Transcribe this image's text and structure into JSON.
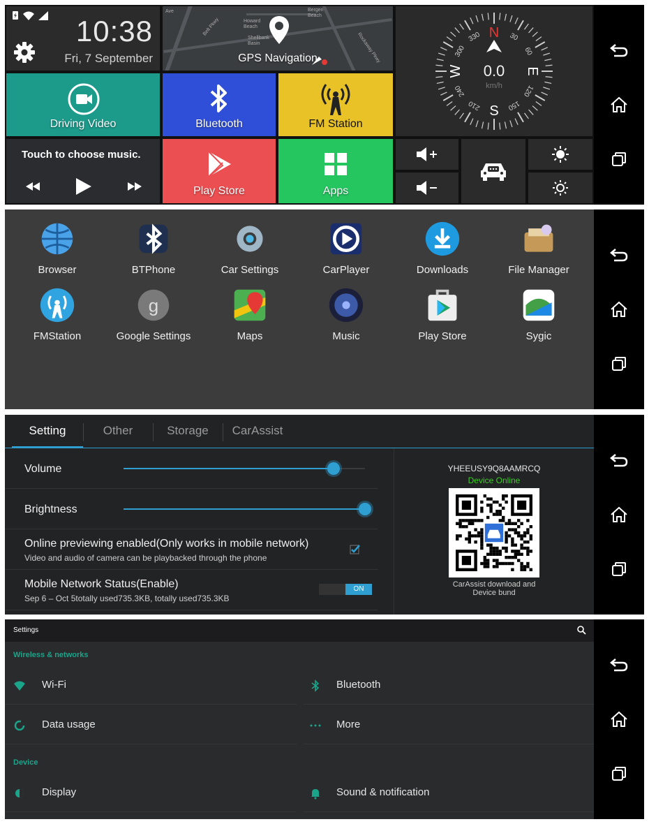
{
  "colors": {
    "teal": "#1c9a8a",
    "blue": "#2f4fd8",
    "yellow": "#e8c226",
    "red": "#ec4f52",
    "green": "#25c560",
    "accent": "#2e9fd0",
    "settings_accent": "#1aa58b",
    "online": "#38d11d"
  },
  "home": {
    "time": "10:38",
    "date": "Fri, 7 September",
    "gps_label": "GPS Navigation",
    "map_labels": [
      "Howard Beach",
      "Shellbank Basin",
      "Belt Pkwy",
      "Bergen Beach",
      "Ave",
      "Rockaway Pkwy"
    ],
    "compass": {
      "north": "N",
      "south": "S",
      "east": "E",
      "west": "W",
      "speed": "0.0",
      "unit": "km/h",
      "ticks": [
        "330",
        "30",
        "300",
        "60",
        "240",
        "120",
        "210",
        "150"
      ]
    },
    "tiles": {
      "driving_video": "Driving Video",
      "bluetooth": "Bluetooth",
      "fm_station": "FM Station",
      "music_prompt": "Touch to choose music.",
      "play_store": "Play Store",
      "apps": "Apps"
    }
  },
  "drawer": {
    "apps": [
      {
        "label": "Browser",
        "icon": "globe-icon"
      },
      {
        "label": "BTPhone",
        "icon": "bluetooth-phone-icon"
      },
      {
        "label": "Car Settings",
        "icon": "gear-icon"
      },
      {
        "label": "CarPlayer",
        "icon": "play-circle-icon"
      },
      {
        "label": "Downloads",
        "icon": "download-icon"
      },
      {
        "label": "File Manager",
        "icon": "folder-icon"
      },
      {
        "label": "FMStation",
        "icon": "radio-tower-icon"
      },
      {
        "label": "Google Settings",
        "icon": "google-settings-icon"
      },
      {
        "label": "Maps",
        "icon": "map-pin-icon"
      },
      {
        "label": "Music",
        "icon": "speaker-icon"
      },
      {
        "label": "Play Store",
        "icon": "play-store-icon"
      },
      {
        "label": "Sygic",
        "icon": "sygic-icon"
      }
    ]
  },
  "carassist": {
    "tabs": [
      "Setting",
      "Other",
      "Storage",
      "CarAssist"
    ],
    "volume_label": "Volume",
    "volume_level": 0.87,
    "brightness_label": "Brightness",
    "brightness_level": 1.0,
    "preview_title": "Online previewing enabled(Only works in mobile network)",
    "preview_sub": "Video and audio of camera can be playbacked through the phone",
    "network_title": "Mobile Network Status(Enable)",
    "network_sub": "Sep 6 – Oct 5totally used735.3KB, totally used735.3KB",
    "toggle_on": "ON",
    "device_id": "YHEEUSY9Q8AAMRCQ",
    "device_status": "Device Online",
    "qr_caption_1": "CarAssist download and",
    "qr_caption_2": "Device bund"
  },
  "settings": {
    "title": "Settings",
    "section_wireless": "Wireless & networks",
    "wifi": "Wi-Fi",
    "bluetooth": "Bluetooth",
    "data_usage": "Data usage",
    "more": "More",
    "section_device": "Device",
    "display": "Display",
    "sound": "Sound & notification"
  }
}
